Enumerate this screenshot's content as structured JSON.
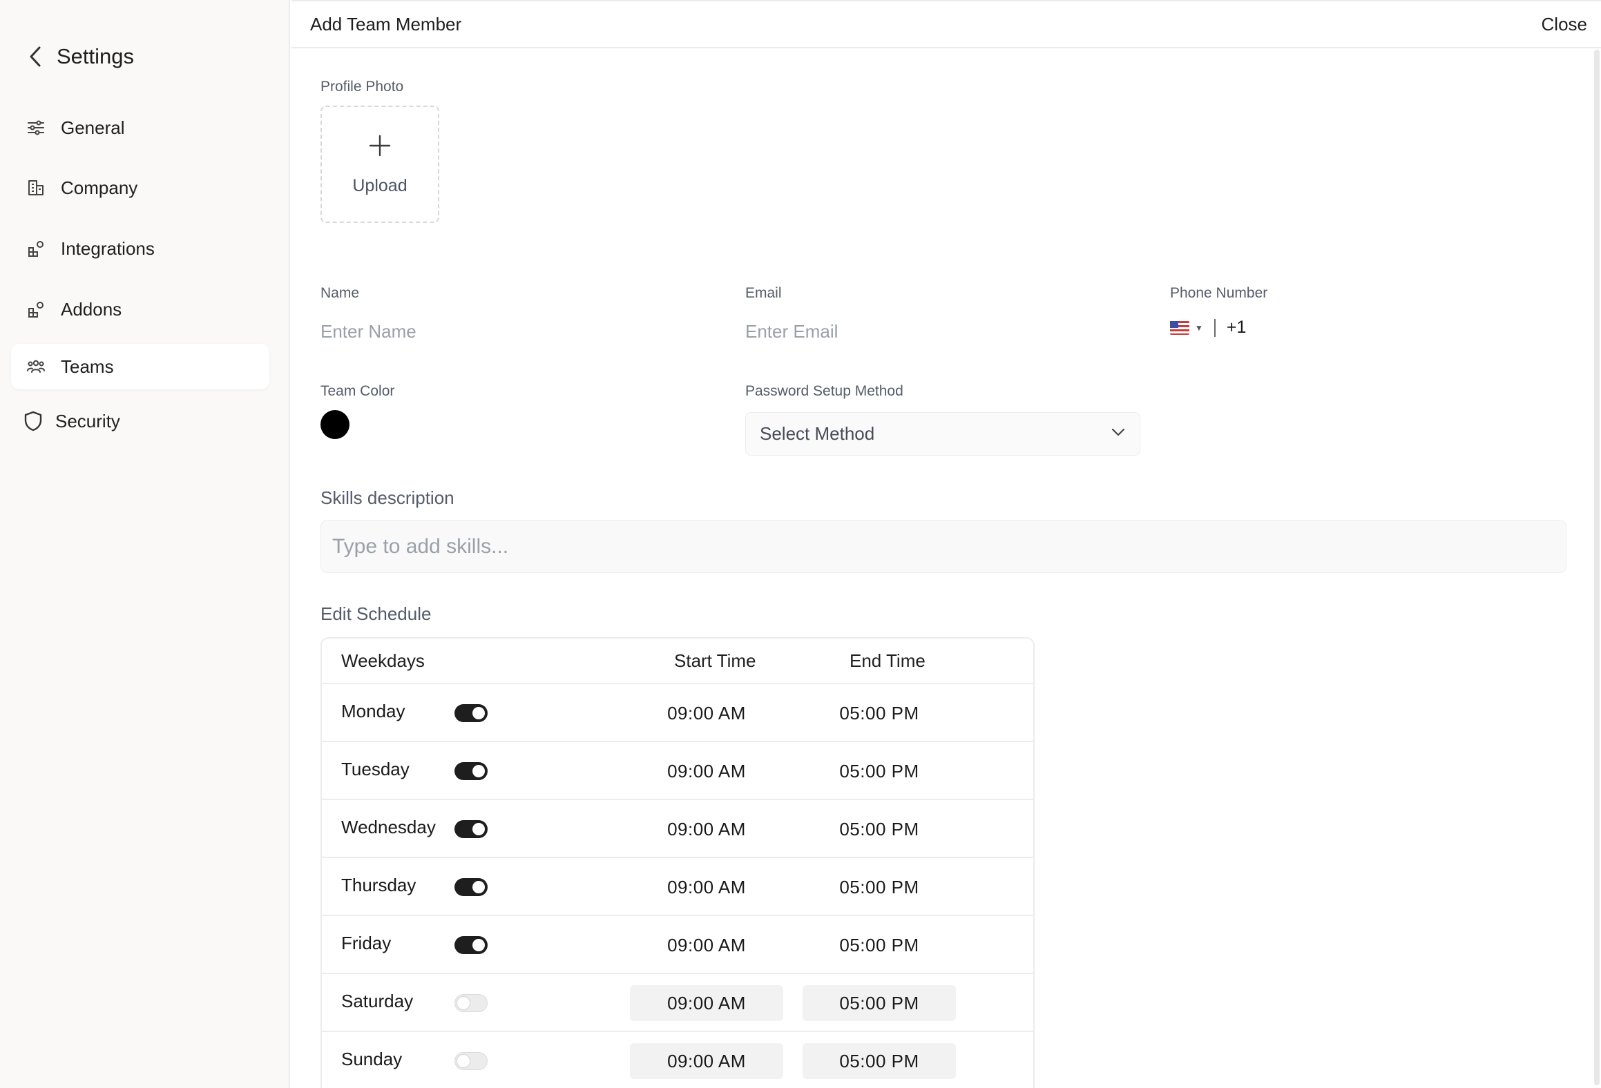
{
  "sidebar": {
    "title": "Settings",
    "items": [
      {
        "label": "General",
        "icon": "sliders-icon"
      },
      {
        "label": "Company",
        "icon": "building-icon"
      },
      {
        "label": "Integrations",
        "icon": "integrations-icon"
      },
      {
        "label": "Addons",
        "icon": "addons-icon"
      },
      {
        "label": "Teams",
        "icon": "team-icon",
        "active": true
      },
      {
        "label": "Security",
        "icon": "shield-icon"
      }
    ]
  },
  "dialog": {
    "title": "Add Team Member",
    "close_label": "Close"
  },
  "form": {
    "profile_photo_label": "Profile Photo",
    "upload_label": "Upload",
    "name_label": "Name",
    "name_placeholder": "Enter Name",
    "email_label": "Email",
    "email_placeholder": "Enter Email",
    "phone_label": "Phone Number",
    "phone_dial_code": "+1",
    "team_color_label": "Team Color",
    "team_color": "#000000",
    "password_label": "Password Setup Method",
    "password_value": "Select Method",
    "skills_label": "Skills description",
    "skills_placeholder": "Type to add skills..."
  },
  "schedule": {
    "title": "Edit Schedule",
    "headers": {
      "weekdays": "Weekdays",
      "start": "Start Time",
      "end": "End Time"
    },
    "days": [
      {
        "day": "Monday",
        "enabled": true,
        "start": "09:00 AM",
        "end": "05:00 PM"
      },
      {
        "day": "Tuesday",
        "enabled": true,
        "start": "09:00 AM",
        "end": "05:00 PM"
      },
      {
        "day": "Wednesday",
        "enabled": true,
        "start": "09:00 AM",
        "end": "05:00 PM"
      },
      {
        "day": "Thursday",
        "enabled": true,
        "start": "09:00 AM",
        "end": "05:00 PM"
      },
      {
        "day": "Friday",
        "enabled": true,
        "start": "09:00 AM",
        "end": "05:00 PM"
      },
      {
        "day": "Saturday",
        "enabled": false,
        "start": "09:00 AM",
        "end": "05:00 PM"
      },
      {
        "day": "Sunday",
        "enabled": false,
        "start": "09:00 AM",
        "end": "05:00 PM"
      }
    ]
  }
}
